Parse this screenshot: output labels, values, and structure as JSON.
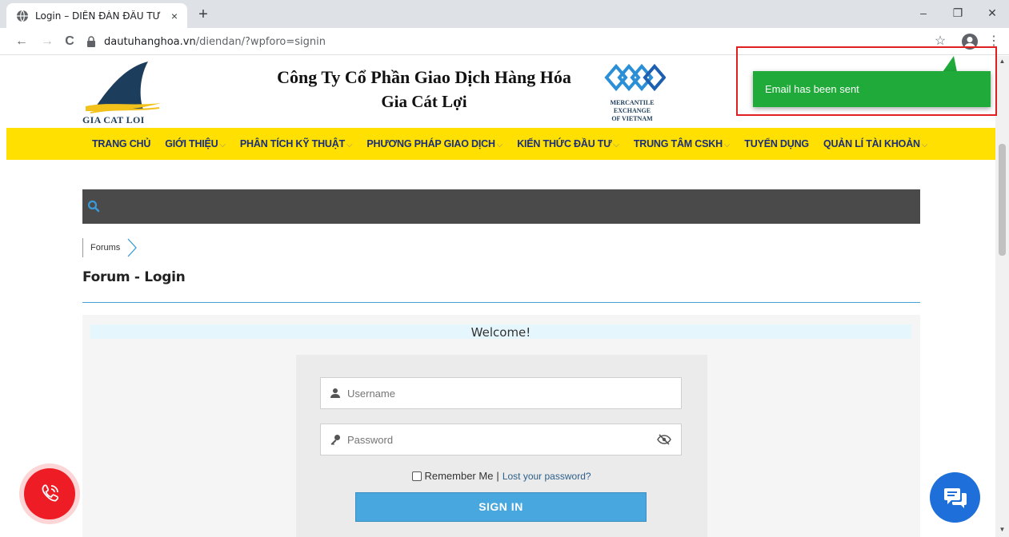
{
  "browser": {
    "tab_title": "Login – DIỄN ĐÀN ĐẦU TƯ HÀNG",
    "tab_close": "×",
    "new_tab": "+",
    "url_domain": "dautuhanghoa.vn",
    "url_path": "/diendan/?wpforo=signin",
    "minimize": "–",
    "restore": "❐",
    "close": "✕",
    "back": "←",
    "forward": "→",
    "reload": "C",
    "star": "☆",
    "menu": "⋮"
  },
  "header": {
    "logo_text": "GIA CAT LOI",
    "company_line1": "Công Ty Cổ Phần Giao Dịch Hàng Hóa",
    "company_line2": "Gia Cát Lợi",
    "mxv_line1": "MERCANTILE",
    "mxv_line2": "EXCHANGE",
    "mxv_line3": "OF VIETNAM",
    "mxv_tm": "™"
  },
  "nav": {
    "items": [
      {
        "label": "TRANG CHỦ",
        "chevron": ""
      },
      {
        "label": "GIỚI THIỆU",
        "chevron": "⌵"
      },
      {
        "label": "PHÂN TÍCH KỸ THUẬT",
        "chevron": "⌵"
      },
      {
        "label": "PHƯƠNG PHÁP GIAO DỊCH",
        "chevron": "⌵"
      },
      {
        "label": "KIẾN THỨC ĐẦU TƯ",
        "chevron": "⌵"
      },
      {
        "label": "TRUNG TÂM CSKH",
        "chevron": "⌵"
      },
      {
        "label": "TUYỂN DỤNG",
        "chevron": ""
      },
      {
        "label": "QUẢN LÍ TÀI KHOẢN",
        "chevron": "⌵"
      }
    ]
  },
  "breadcrumb": {
    "label": "Forums"
  },
  "page": {
    "title": "Forum - Login"
  },
  "login": {
    "welcome": "Welcome!",
    "username_placeholder": "Username",
    "password_placeholder": "Password",
    "remember": "Remember Me",
    "separator": "|",
    "lost_password": "Lost your password?",
    "signin": "SIGN IN"
  },
  "toast": {
    "message": "Email has been sent"
  },
  "colors": {
    "nav_bg": "#ffe000",
    "nav_text": "#1a2e7a",
    "accent": "#47a7de",
    "toast_bg": "#1faa3a",
    "highlight": "#e02020"
  }
}
